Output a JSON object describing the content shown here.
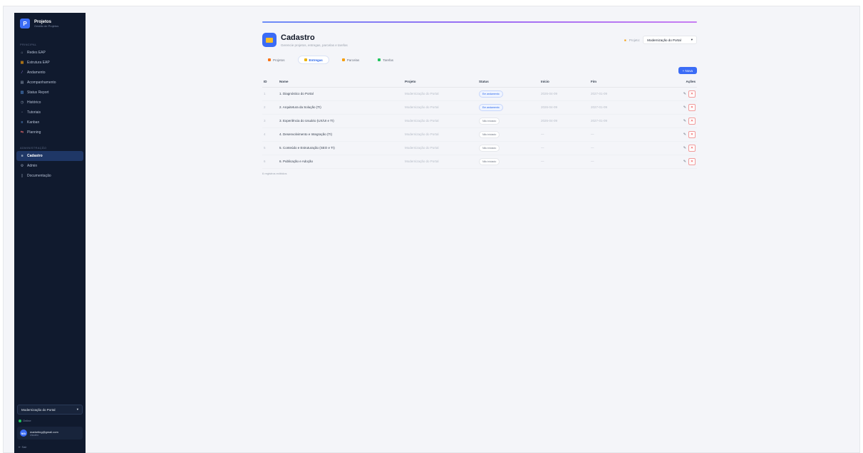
{
  "sidebar": {
    "brand_title": "Projetos",
    "brand_sub": "Gestão de Projetos",
    "section_main": "Principal",
    "items": [
      {
        "icon": "⌂",
        "label": "Redes EAP"
      },
      {
        "icon": "▦",
        "label": "Estrutura EAP"
      },
      {
        "icon": "⁄",
        "label": "Andamento"
      },
      {
        "icon": "▤",
        "label": "Acompanhamento"
      },
      {
        "icon": "▥",
        "label": "Status Report"
      },
      {
        "icon": "◷",
        "label": "Histórico"
      },
      {
        "icon": "▫",
        "label": "Tutoriais"
      },
      {
        "icon": "≡",
        "label": "Kanban"
      },
      {
        "icon": "⇆",
        "label": "Planning"
      }
    ],
    "section_admin": "Administração",
    "admin_items": [
      {
        "icon": "■",
        "label": "Cadastro"
      },
      {
        "icon": "⚙",
        "label": "Admin"
      },
      {
        "icon": "▯",
        "label": "Documentação"
      }
    ],
    "project_select": "Modernização do Portal",
    "online_label": "Online",
    "user_initials": "MA",
    "user_email": "marketing@gmail.com",
    "user_role": "Usuário",
    "logout_label": "Sair"
  },
  "header": {
    "title": "Cadastro",
    "subtitle": "Gerencie projetos, entregas, parcelas e tarefas",
    "project_label": "Projeto:",
    "project_value": "Modernização do Portal"
  },
  "tabs": [
    {
      "label": "Projetos",
      "color": "#f97316"
    },
    {
      "label": "Entregas",
      "color": "#eab308"
    },
    {
      "label": "Parcelas",
      "color": "#f59e0b"
    },
    {
      "label": "Tarefas",
      "color": "#22c55e"
    }
  ],
  "new_button": "+ Nova",
  "table": {
    "columns": [
      "ID",
      "Nome",
      "Projeto",
      "Status",
      "Início",
      "Fim",
      "Ações"
    ],
    "rows": [
      {
        "id": "1",
        "nome": "1. Diagnóstico do Portal",
        "projeto": "Modernização do Portal",
        "status": "Em andamento",
        "inicio": "2026-04-09",
        "fim": "2027-01-09"
      },
      {
        "id": "2",
        "nome": "2. Arquitetura da Solução (TI)",
        "projeto": "Modernização do Portal",
        "status": "Em andamento",
        "inicio": "2026-04-09",
        "fim": "2027-01-09"
      },
      {
        "id": "3",
        "nome": "3. Experiência do Usuário (UX/UI e TI)",
        "projeto": "Modernização do Portal",
        "status": "Não iniciado",
        "inicio": "2026-04-09",
        "fim": "2027-01-09"
      },
      {
        "id": "4",
        "nome": "4. Desenvolvimento e Integração (TI)",
        "projeto": "Modernização do Portal",
        "status": "Não iniciado",
        "inicio": "—",
        "fim": "—"
      },
      {
        "id": "5",
        "nome": "5. Conteúdo e Estruturação (SEO e TI)",
        "projeto": "Modernização do Portal",
        "status": "Não iniciado",
        "inicio": "—",
        "fim": "—"
      },
      {
        "id": "6",
        "nome": "6. Publicação e Adoção",
        "projeto": "Modernização do Portal",
        "status": "Não iniciado",
        "inicio": "—",
        "fim": "—"
      }
    ]
  },
  "count_label": "6 registros exibidos"
}
